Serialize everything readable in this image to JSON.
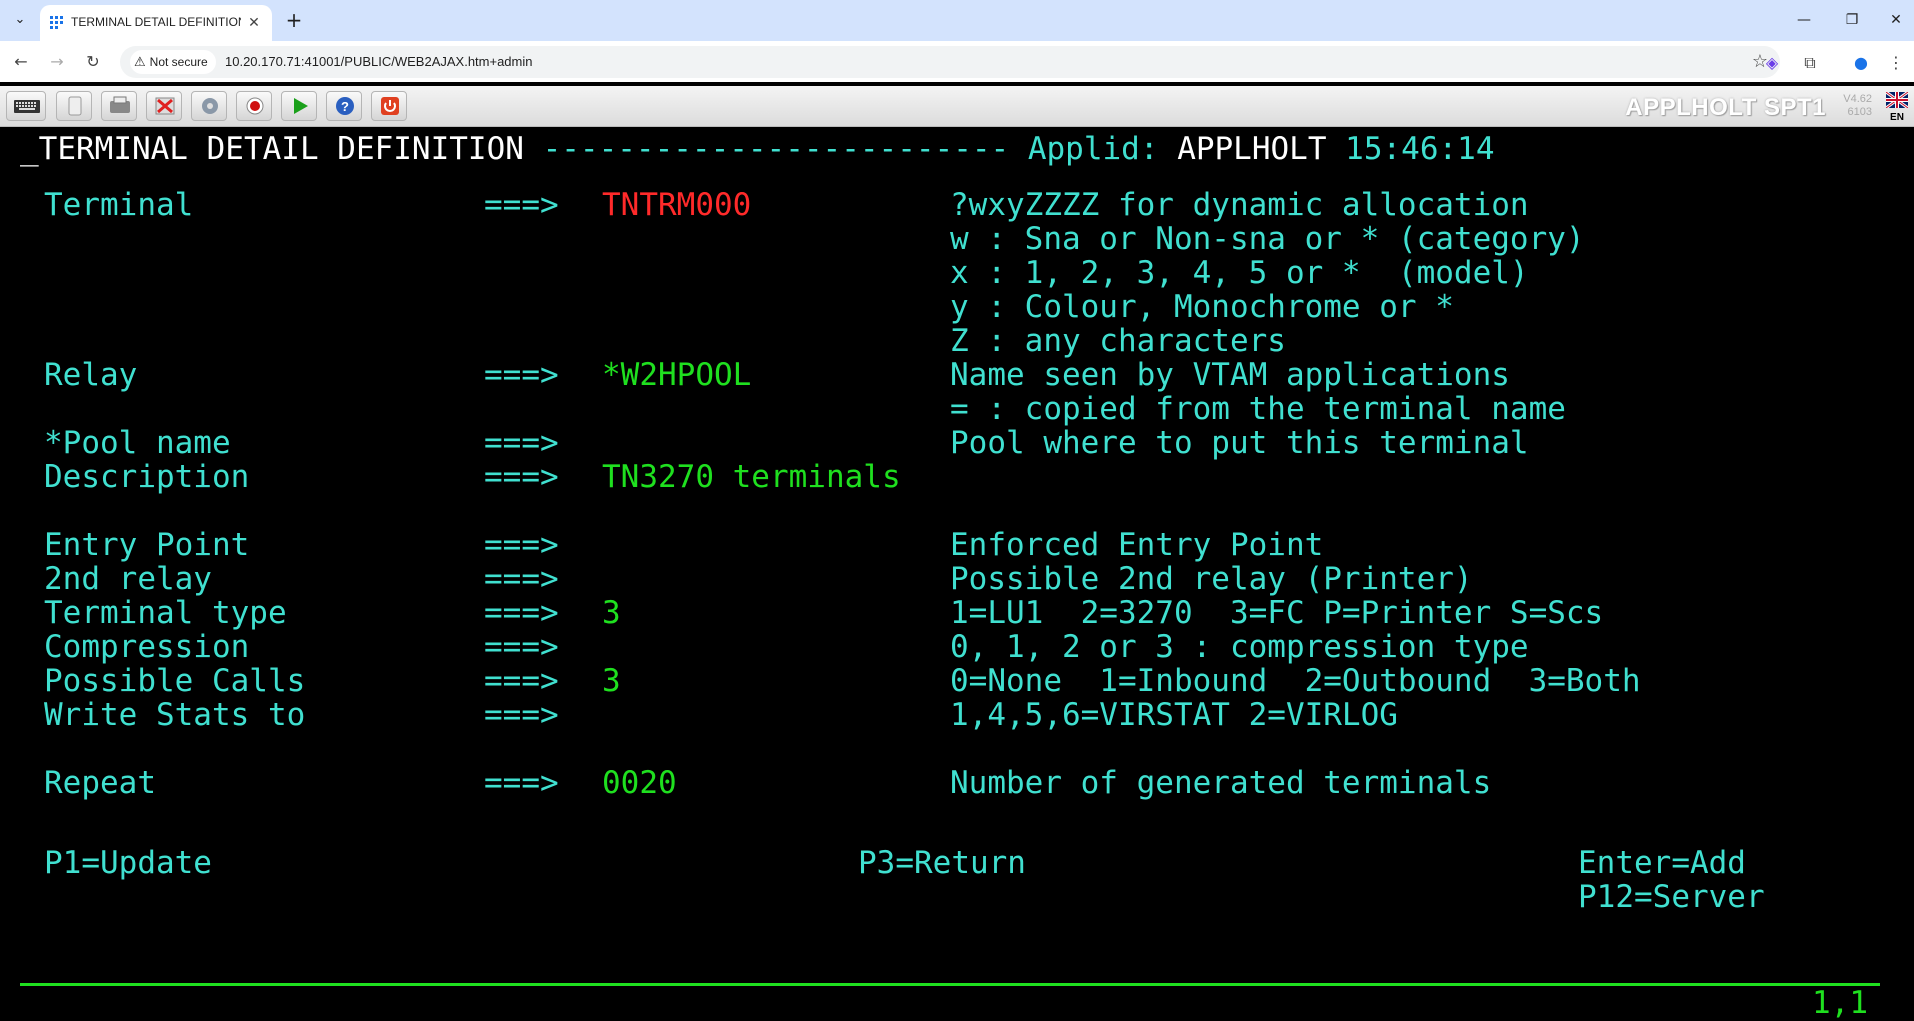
{
  "browser": {
    "tab_title": "TERMINAL DETAIL DEFINITION",
    "security_label": "Not secure",
    "url": "10.20.170.71:41001/PUBLIC/WEB2AJAX.htm+admin"
  },
  "toolbar": {
    "system_name": "APPLHOLT SPT1",
    "version": "V4.62",
    "build": "6103",
    "language": "EN",
    "buttons": [
      "keyboard-icon",
      "clipboard-icon",
      "print-icon",
      "disconnect-icon",
      "settings-icon",
      "record-icon",
      "play-icon",
      "help-icon",
      "power-icon"
    ]
  },
  "screen": {
    "title": "_TERMINAL DETAIL DEFINITION",
    "title_dashes": "-------------------------",
    "applid_label": "Applid:",
    "applid_value": "APPLHOLT",
    "time": "15:46:14",
    "arrow": "===>",
    "rows": [
      {
        "label": "Terminal",
        "value": "TNTRM000",
        "help": "?wxyZZZZ for dynamic allocation"
      },
      {
        "label": "",
        "value": "",
        "help": "w : Sna or Non-sna or * (category)"
      },
      {
        "label": "",
        "value": "",
        "help": "x : 1, 2, 3, 4, 5 or *  (model)"
      },
      {
        "label": "",
        "value": "",
        "help": "y : Colour, Monochrome or *"
      },
      {
        "label": "",
        "value": "",
        "help": "Z : any characters"
      },
      {
        "label": "Relay",
        "value": "*W2HPOOL",
        "help": "Name seen by VTAM applications"
      },
      {
        "label": "",
        "value": "",
        "help": "= : copied from the terminal name"
      },
      {
        "label": "*Pool name",
        "value": "",
        "help": "Pool where to put this terminal"
      },
      {
        "label": "Description",
        "value": "TN3270 terminals",
        "help": ""
      },
      {
        "label": "Entry Point",
        "value": "",
        "help": "Enforced Entry Point"
      },
      {
        "label": "2nd relay",
        "value": "",
        "help": "Possible 2nd relay (Printer)"
      },
      {
        "label": "Terminal type",
        "value": "3",
        "help": "1=LU1  2=3270  3=FC P=Printer S=Scs"
      },
      {
        "label": "Compression",
        "value": "",
        "help": "0, 1, 2 or 3 : compression type"
      },
      {
        "label": "Possible Calls",
        "value": "3",
        "help": "0=None  1=Inbound  2=Outbound  3=Both"
      },
      {
        "label": "Write Stats to",
        "value": "",
        "help": "1,4,5,6=VIRSTAT 2=VIRLOG"
      },
      {
        "label": "Repeat",
        "value": "0020",
        "help": "Number of generated terminals"
      }
    ],
    "pfkeys": {
      "p1": "P1=Update",
      "p3": "P3=Return",
      "enter": "Enter=Add",
      "p12": "P12=Server"
    },
    "cursor_position": "1,1"
  }
}
